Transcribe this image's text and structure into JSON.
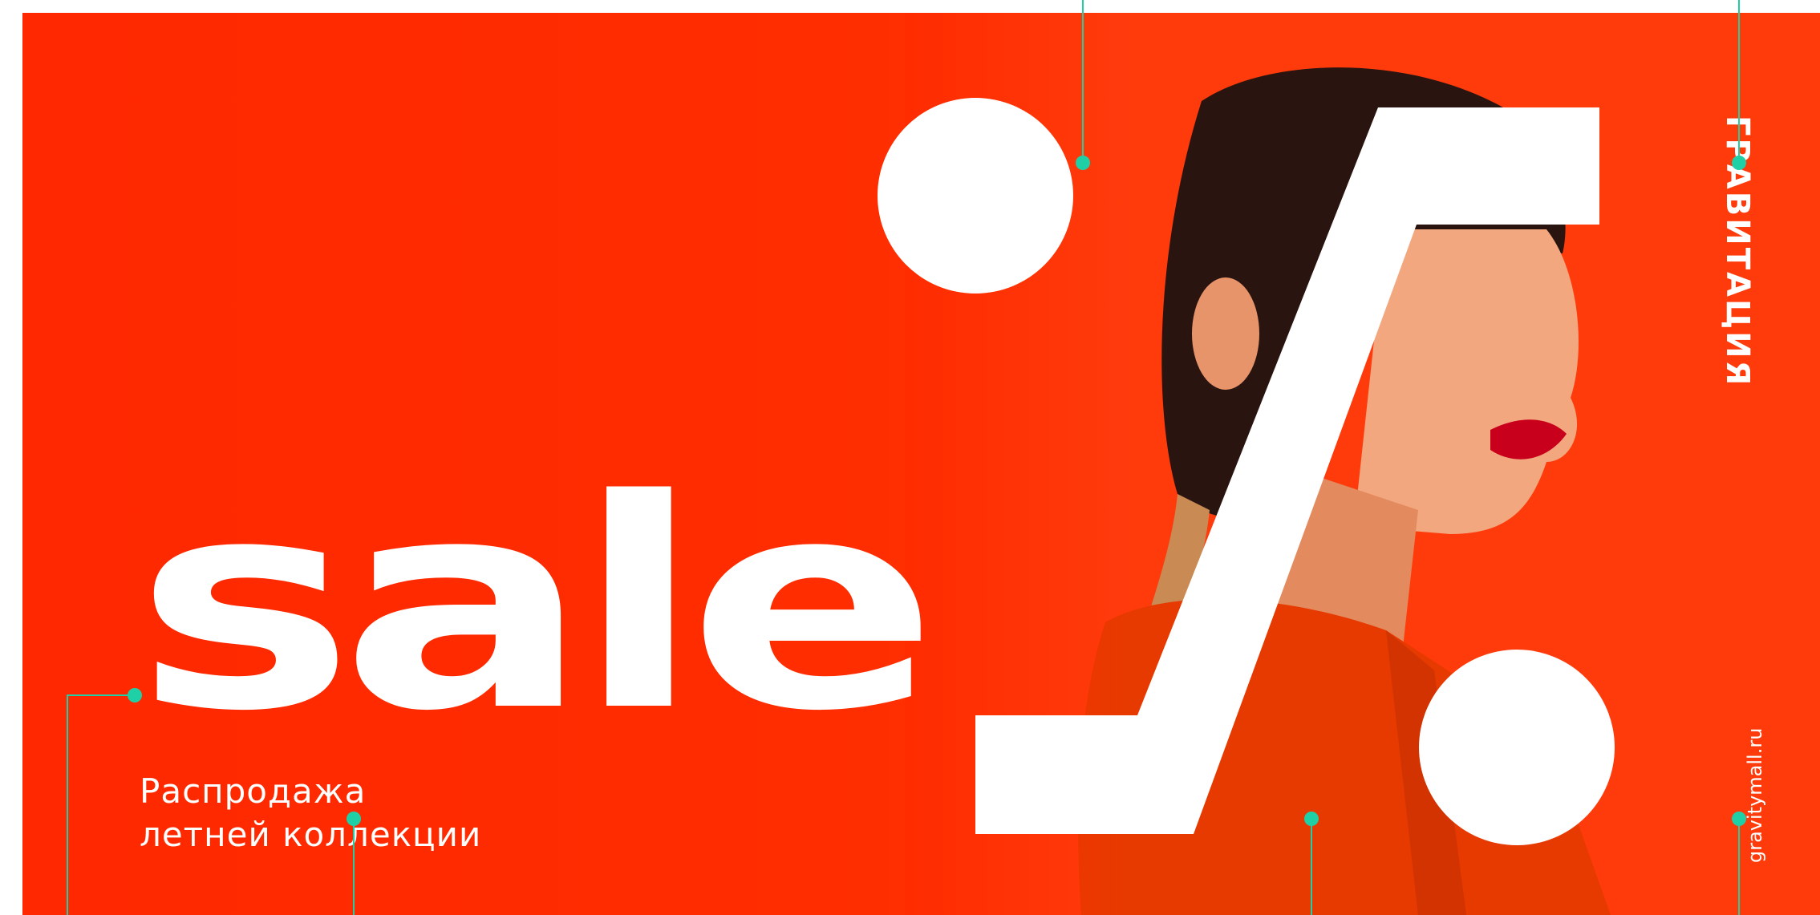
{
  "banner": {
    "headline": "sale",
    "subtitle_line1": "Распродажа",
    "subtitle_line2": "летней коллекции",
    "brand": "ГРАВИТАЦИЯ",
    "website": "gravitymall.ru"
  },
  "colors": {
    "background": "#ff2800",
    "shape": "#ffffff",
    "marker": "#1fd0a6"
  },
  "icons": [
    "percent-sign-icon"
  ]
}
